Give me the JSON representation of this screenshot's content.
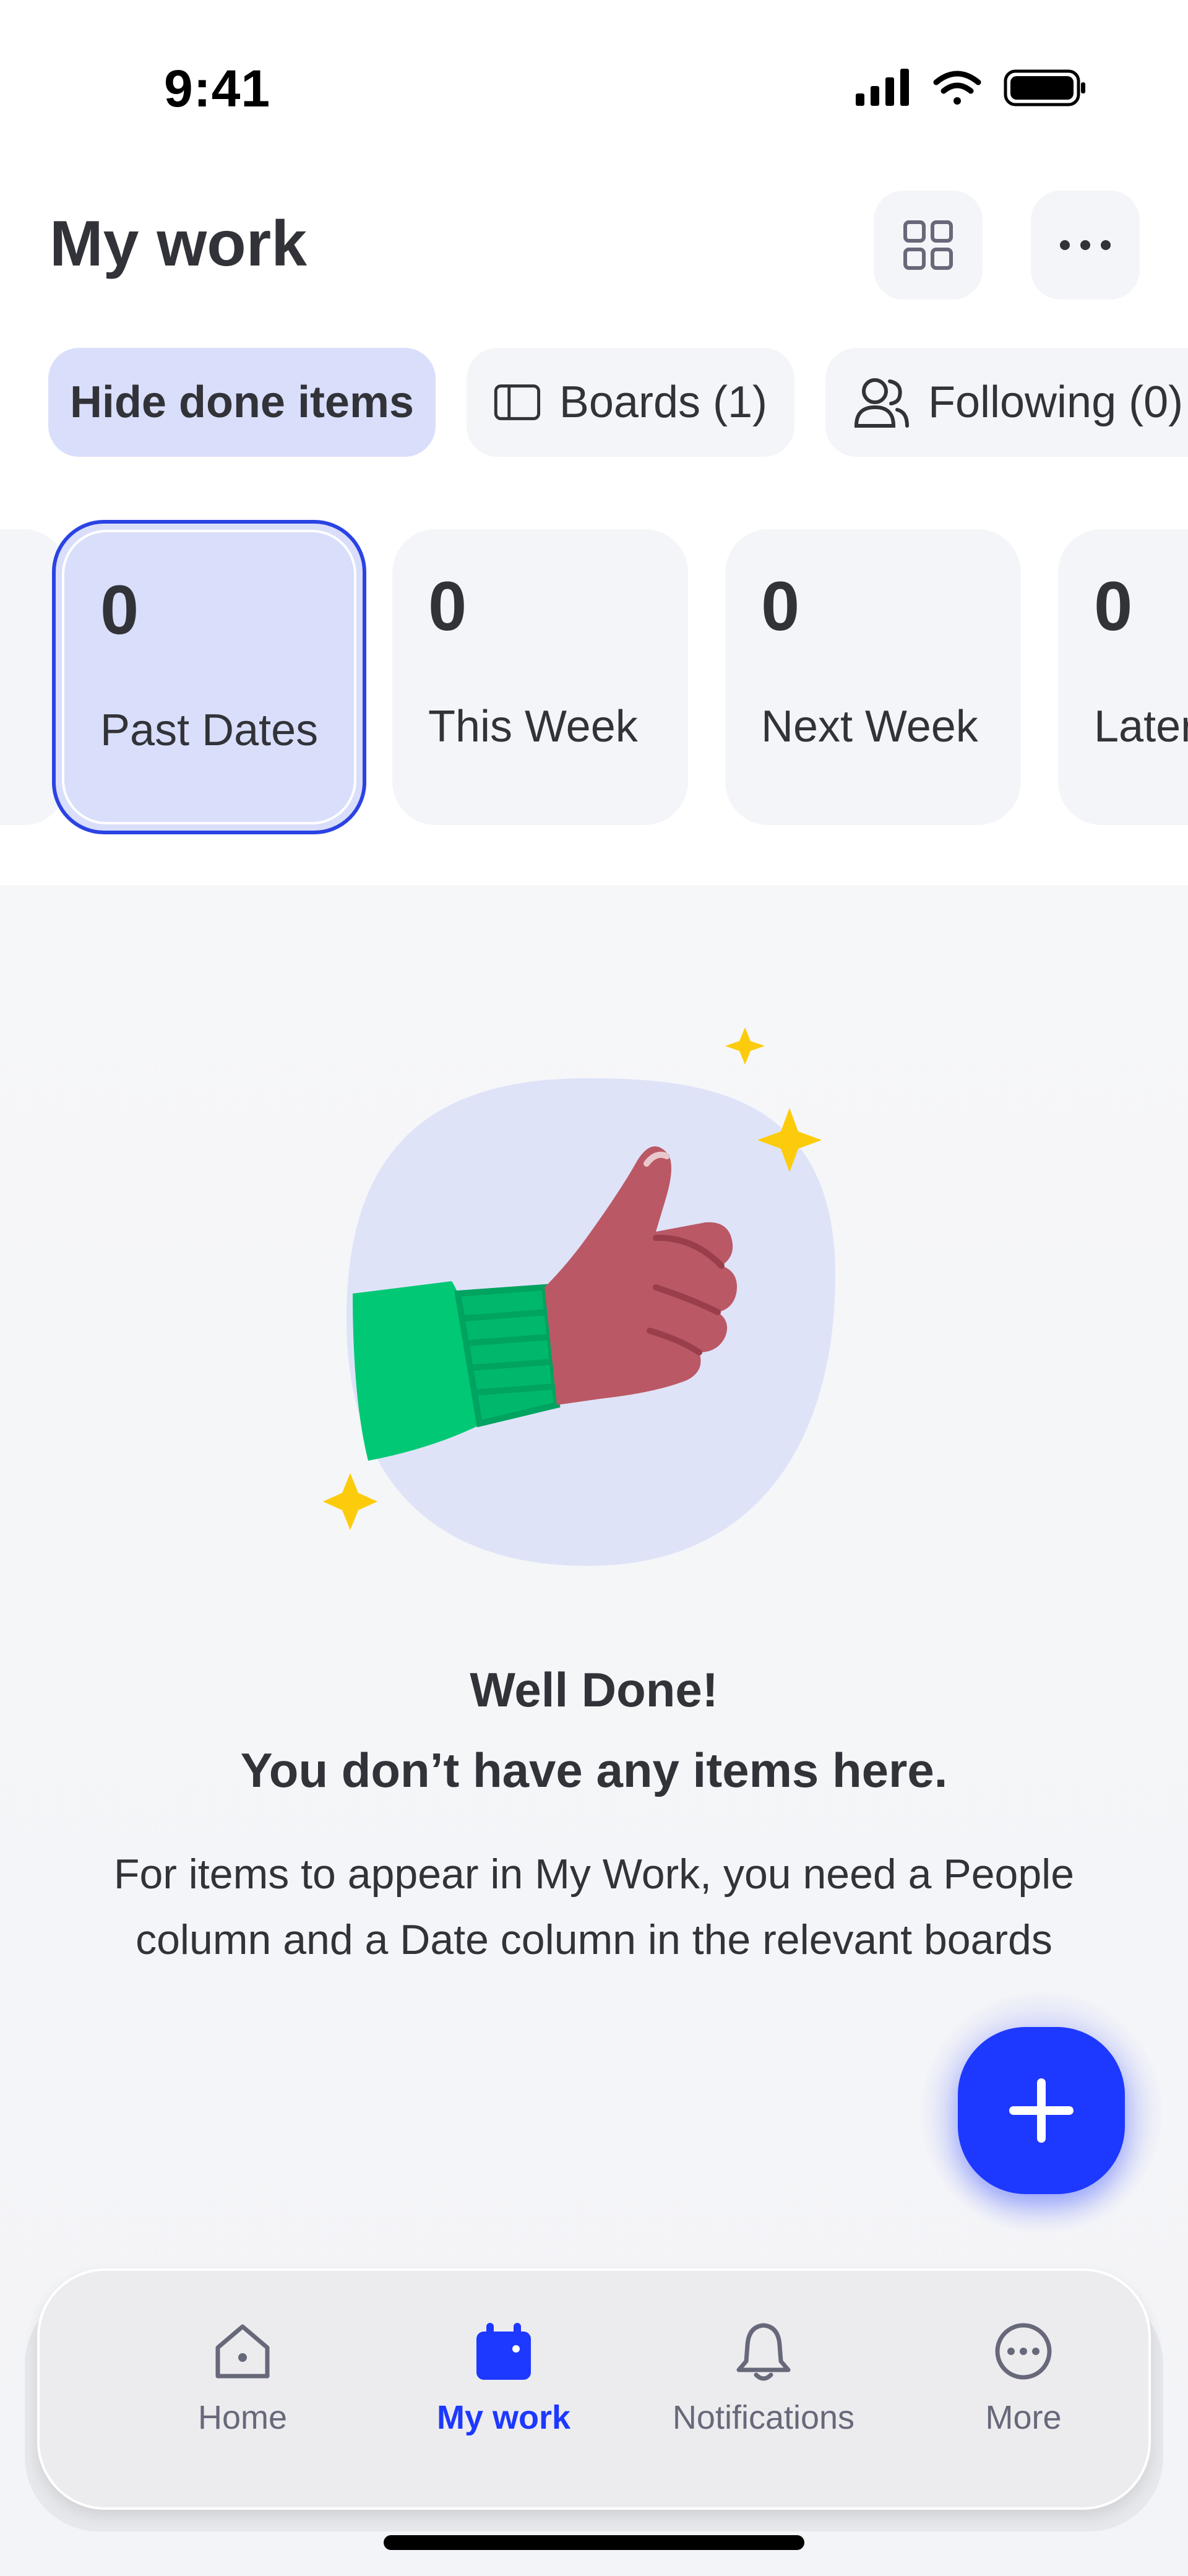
{
  "status_bar": {
    "time": "9:41",
    "icons": [
      "signal-icon",
      "wifi-icon",
      "battery-icon"
    ]
  },
  "header": {
    "title": "My work",
    "buttons": [
      "grid-view-icon",
      "more-options-icon"
    ]
  },
  "filters": {
    "hide_done": "Hide done items",
    "boards": "Boards (1)",
    "following": "Following (0)"
  },
  "date_cards": [
    {
      "count": "0",
      "label": "Past Dates",
      "selected": true
    },
    {
      "count": "0",
      "label": "This Week",
      "selected": false
    },
    {
      "count": "0",
      "label": "Next Week",
      "selected": false
    },
    {
      "count": "0",
      "label": "Later",
      "selected": false
    }
  ],
  "empty_state": {
    "title_line1": "Well Done!",
    "title_line2": "You don’t have any items here.",
    "body": "For items to appear in My Work, you need a People column and a Date column in the relevant boards",
    "illustration": "thumbs-up-illustration"
  },
  "fab": {
    "icon": "plus-icon"
  },
  "bottom_nav": [
    {
      "label": "Home",
      "icon": "home-icon",
      "active": false
    },
    {
      "label": "My work",
      "icon": "calendar-icon",
      "active": true
    },
    {
      "label": "Notifications",
      "icon": "bell-icon",
      "active": false
    },
    {
      "label": "More",
      "icon": "more-circle-icon",
      "active": false
    }
  ],
  "colors": {
    "accent": "#1d38ff",
    "selected_bg": "#d9defb",
    "selected_border": "#2b43e3",
    "chip_bg": "#f4f5f8",
    "text": "#323338",
    "muted_text": "#676879"
  }
}
